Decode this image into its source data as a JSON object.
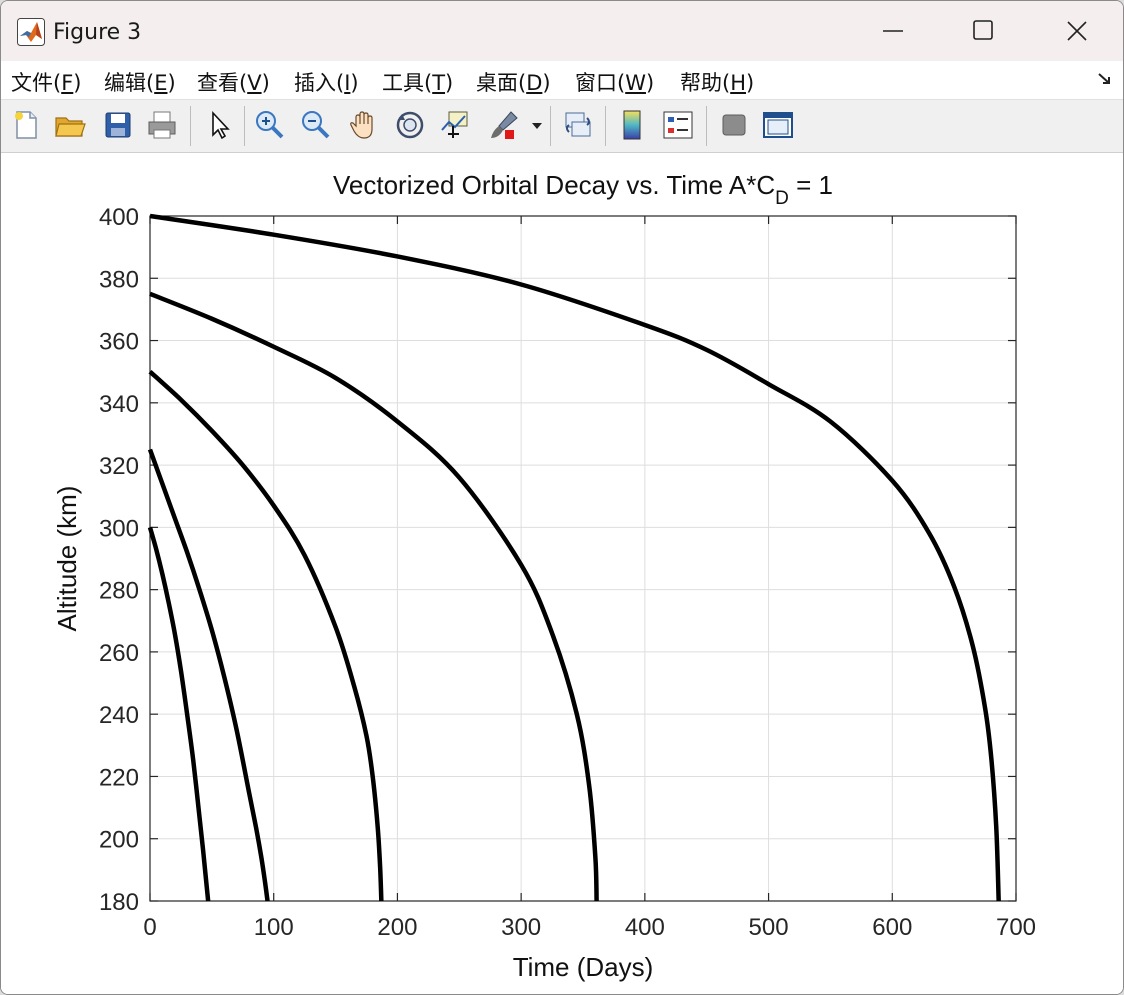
{
  "window": {
    "title": "Figure 3"
  },
  "menu": {
    "file": "文件(",
    "file_key": "F",
    "edit": "编辑(",
    "edit_key": "E",
    "view": "查看(",
    "view_key": "V",
    "insert": "插入(",
    "insert_key": "I",
    "tools": "工具(",
    "tools_key": "T",
    "desktop": "桌面(",
    "desktop_key": "D",
    "window": "窗口(",
    "window_key": "W",
    "help": "帮助(",
    "help_key": "H",
    "close_paren": ")"
  },
  "toolbar_icons": [
    "new-file-icon",
    "open-folder-icon",
    "save-icon",
    "print-icon",
    "pointer-icon",
    "zoom-in-icon",
    "zoom-out-icon",
    "pan-hand-icon",
    "rotate-3d-icon",
    "data-cursor-icon",
    "brush-icon",
    "brush-dropdown-icon",
    "link-plot-icon",
    "colorbar-icon",
    "legend-icon",
    "hide-plot-tools-icon",
    "show-plot-tools-icon"
  ],
  "chart_data": {
    "type": "line",
    "title_main": "Vectorized Orbital Decay vs. Time A*C",
    "title_sub": "D",
    "title_tail": " = 1",
    "xlabel": "Time (Days)",
    "ylabel": "Altitude (km)",
    "xlim": [
      0,
      700
    ],
    "ylim": [
      180,
      400
    ],
    "xticks": [
      0,
      100,
      200,
      300,
      400,
      500,
      600,
      700
    ],
    "yticks": [
      180,
      200,
      220,
      240,
      260,
      280,
      300,
      320,
      340,
      360,
      380,
      400
    ],
    "grid": true,
    "line_color": "#000000",
    "series": [
      {
        "x": [
          0,
          5,
          10,
          15,
          20,
          25,
          30,
          35,
          40,
          43,
          45,
          46.5,
          47
        ],
        "y": [
          300,
          293,
          285,
          276,
          266,
          254,
          240,
          225,
          207,
          196,
          188,
          182,
          180
        ]
      },
      {
        "x": [
          0,
          10,
          20,
          30,
          40,
          50,
          60,
          70,
          80,
          86,
          90,
          93,
          95
        ],
        "y": [
          325,
          314,
          303,
          292,
          280,
          267,
          252,
          235,
          215,
          203,
          194,
          186,
          180
        ]
      },
      {
        "x": [
          0,
          25,
          50,
          75,
          100,
          125,
          150,
          165,
          175,
          180,
          184,
          186,
          187
        ],
        "y": [
          350,
          341,
          331,
          320,
          307,
          291,
          268,
          249,
          233,
          220,
          204,
          191,
          180
        ]
      },
      {
        "x": [
          0,
          50,
          100,
          150,
          200,
          250,
          300,
          325,
          345,
          355,
          360,
          361
        ],
        "y": [
          375,
          367,
          358,
          348,
          334,
          316,
          288,
          266,
          240,
          217,
          194,
          180
        ]
      },
      {
        "x": [
          0,
          100,
          200,
          300,
          400,
          450,
          500,
          550,
          600,
          630,
          650,
          665,
          675,
          680,
          684,
          686
        ],
        "y": [
          400,
          394,
          387,
          378,
          365,
          357,
          346,
          334,
          315,
          298,
          281,
          262,
          242,
          226,
          204,
          180
        ]
      }
    ]
  }
}
